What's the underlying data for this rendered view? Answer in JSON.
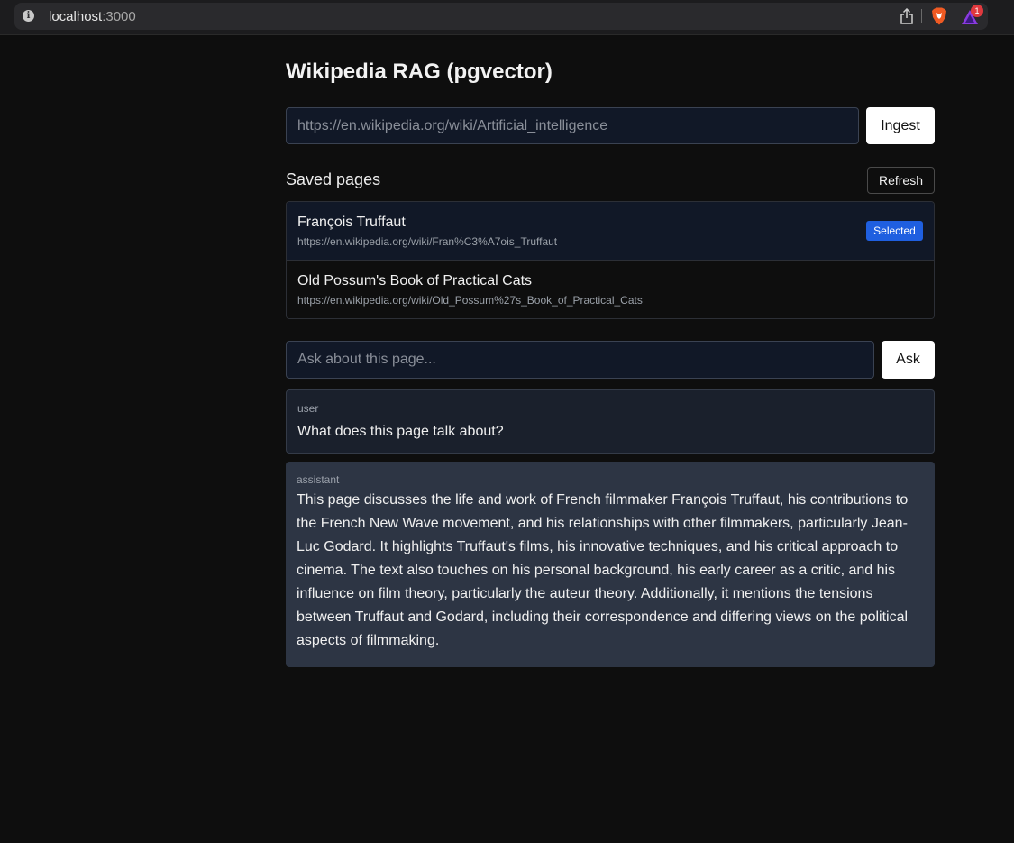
{
  "browser": {
    "url_host": "localhost",
    "url_port": ":3000",
    "notification_count": "1"
  },
  "app": {
    "title": "Wikipedia RAG (pgvector)",
    "url_input": {
      "placeholder": "https://en.wikipedia.org/wiki/Artificial_intelligence",
      "value": ""
    },
    "ingest_label": "Ingest"
  },
  "saved_pages": {
    "heading": "Saved pages",
    "refresh_label": "Refresh",
    "items": [
      {
        "title": "François Truffaut",
        "url": "https://en.wikipedia.org/wiki/Fran%C3%A7ois_Truffaut",
        "selected": true,
        "badge": "Selected"
      },
      {
        "title": "Old Possum's Book of Practical Cats",
        "url": "https://en.wikipedia.org/wiki/Old_Possum%27s_Book_of_Practical_Cats",
        "selected": false
      }
    ]
  },
  "ask": {
    "placeholder": "Ask about this page...",
    "button_label": "Ask"
  },
  "messages": [
    {
      "role": "user",
      "text": "What does this page talk about?"
    },
    {
      "role": "assistant",
      "text": "This page discusses the life and work of French filmmaker François Truffaut, his contributions to the French New Wave movement, and his relationships with other filmmakers, particularly Jean-Luc Godard. It highlights Truffaut's films, his innovative techniques, and his critical approach to cinema. The text also touches on his personal background, his early career as a critic, and his influence on film theory, particularly the auteur theory. Additionally, it mentions the tensions between Truffaut and Godard, including their correspondence and differing views on the political aspects of filmmaking."
    }
  ],
  "colors": {
    "page_bg": "#0e0e0e",
    "input_bg": "#111827",
    "selected_badge": "#1f5fe0",
    "assistant_bg": "#2d3544",
    "user_bg": "#1a202c"
  }
}
